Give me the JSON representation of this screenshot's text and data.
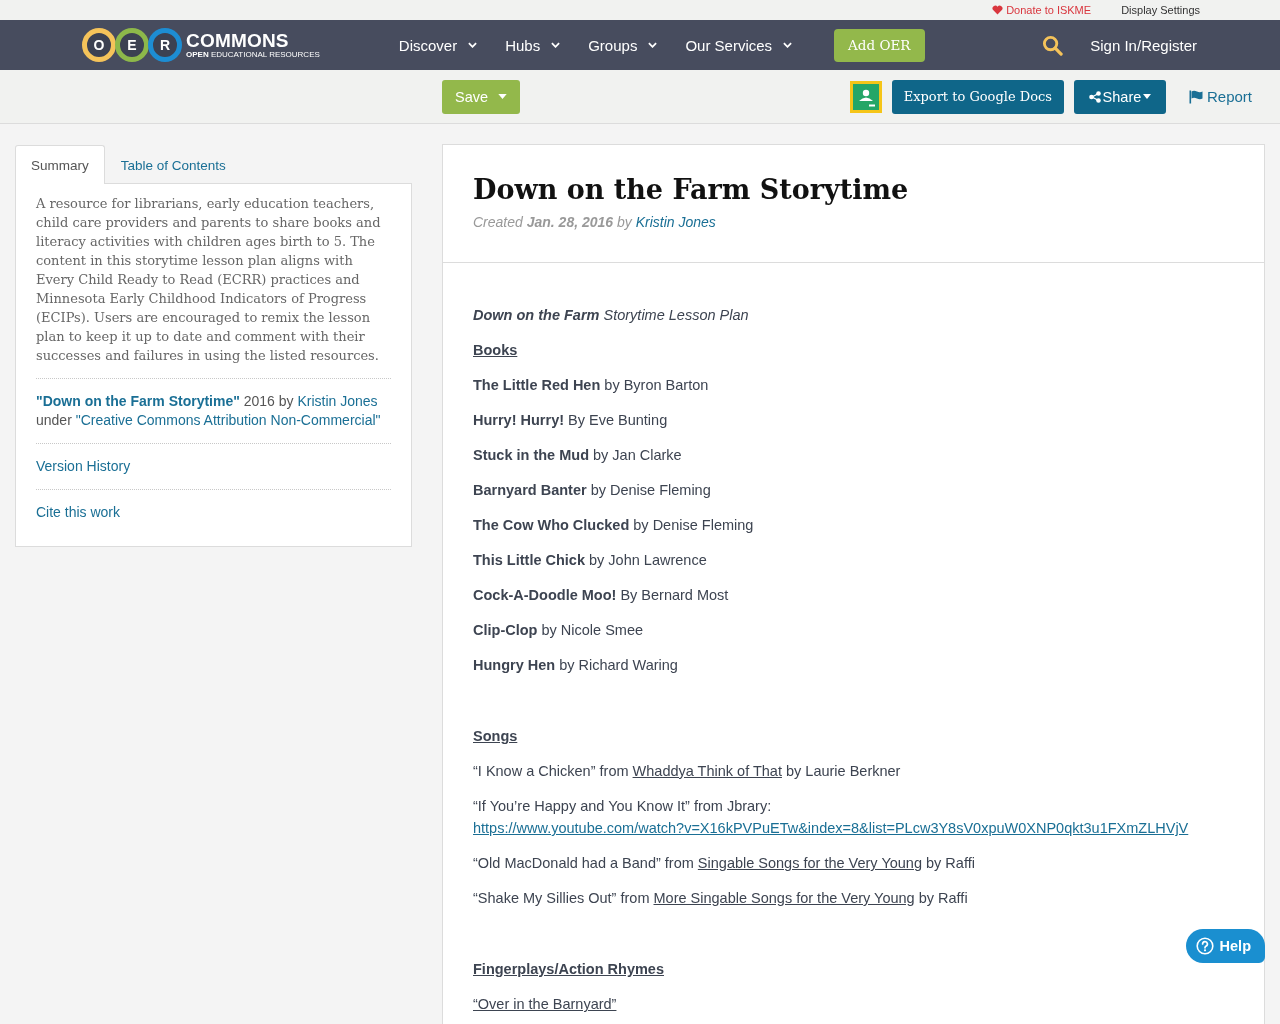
{
  "utility_bar": {
    "links": [
      {
        "kind": "donate",
        "label": "Donate to ISKME"
      },
      {
        "kind": "plain",
        "label": "Display Settings"
      }
    ]
  },
  "nav": {
    "logo": {
      "letters": [
        {
          "letter": "O",
          "color": "#f5c35a"
        },
        {
          "letter": "E",
          "color": "#8db84a"
        },
        {
          "letter": "R",
          "color": "#1d8dd3"
        }
      ],
      "wordmark": "COMMONS",
      "tagline": "**OPEN** EDUCATIONAL RESOURCES"
    },
    "menu": [
      {
        "label": "Discover",
        "dropdown": true
      },
      {
        "label": "Hubs",
        "dropdown": true
      },
      {
        "label": "Groups",
        "dropdown": true
      },
      {
        "label": "Our Services",
        "dropdown": true
      }
    ],
    "add_button": "Add OER",
    "sign_in": "Sign In/Register"
  },
  "toolbar": {
    "save_button": "Save",
    "export_button": "Export to Google Docs",
    "share_button": "Share",
    "report_link": "Report"
  },
  "sidebar": {
    "tabs": [
      {
        "label": "Summary",
        "selected": true
      },
      {
        "label": "Table of Contents",
        "selected": false
      }
    ],
    "summary": "A resource for librarians, early education teachers, child care providers and parents to share books and literacy activities with children ages birth to 5. The content in this storytime lesson plan aligns with Every Child Ready to Read (ECRR) practices and Minnesota Early Childhood Indicators of Progress (ECIPs). Users are encouraged to remix the lesson plan to keep it up to date and comment with their successes and failures in using the listed resources.",
    "attribution": {
      "title": "\"Down on the Farm Storytime\"",
      "year_by": "2016 by",
      "author": "Kristin Jones",
      "under": "under",
      "license": "\"Creative Commons Attribution Non-Commercial\""
    },
    "links": [
      "Version History",
      "Cite this work"
    ]
  },
  "resource": {
    "title": "Down on the Farm Storytime",
    "created": "Created **Jan. 28, 2016** by",
    "author": "Kristin Jones",
    "intro": "**Down on the Farm** Storytime Lesson Plan",
    "sections": [
      {
        "heading": "Books",
        "entries": [
          {
            "kind": "book",
            "text": "**The Little Red Hen** by Byron Barton"
          },
          {
            "kind": "book",
            "text": "**Hurry! Hurry!** By Eve Bunting"
          },
          {
            "kind": "book",
            "text": "**Stuck in the Mud** by Jan Clarke"
          },
          {
            "kind": "book",
            "text": "**Barnyard Banter** by Denise Fleming"
          },
          {
            "kind": "book",
            "text": "**The Cow Who Clucked** by Denise Fleming"
          },
          {
            "kind": "book",
            "text": "**This Little Chick** by John Lawrence"
          },
          {
            "kind": "book",
            "text": "**Cock-A-Doodle Moo!** By Bernard Most"
          },
          {
            "kind": "book",
            "text": "**Clip-Clop** by Nicole Smee"
          },
          {
            "kind": "book",
            "text": "**Hungry Hen** by Richard Waring"
          }
        ]
      },
      {
        "heading": "Songs",
        "entries": [
          {
            "kind": "song",
            "parts": [
              {
                "kind": "plain",
                "text": "“I Know a Chicken” from"
              },
              {
                "kind": "underline",
                "text": "Whaddya Think of That"
              },
              {
                "kind": "plain",
                "text": "by Laurie Berkner"
              }
            ]
          },
          {
            "kind": "song",
            "parts": [
              {
                "kind": "plain",
                "text": "“If You’re Happy and You Know It” from Jbrary:"
              },
              {
                "kind": "link",
                "text": "https://www.youtube.com/watch?v=X16kPVPuETw&index=8&list=PLcw3Y8sV0xpuW0XNP0qkt3u1FXmZLHVjV"
              }
            ]
          },
          {
            "kind": "song",
            "parts": [
              {
                "kind": "plain",
                "text": "“Old MacDonald had a Band” from"
              },
              {
                "kind": "underline",
                "text": "Singable Songs for the Very Young"
              },
              {
                "kind": "plain",
                "text": "by Raffi"
              }
            ]
          },
          {
            "kind": "song",
            "parts": [
              {
                "kind": "plain",
                "text": "“Shake My Sillies Out” from"
              },
              {
                "kind": "underline",
                "text": "More Singable Songs for the Very Young"
              },
              {
                "kind": "plain",
                "text": "by Raffi"
              }
            ]
          }
        ]
      },
      {
        "heading": "Fingerplays/Action Rhymes",
        "entries": [
          {
            "kind": "rhyme",
            "text": "“Over in the Barnyard”"
          }
        ]
      }
    ]
  },
  "help_button": "Help"
}
